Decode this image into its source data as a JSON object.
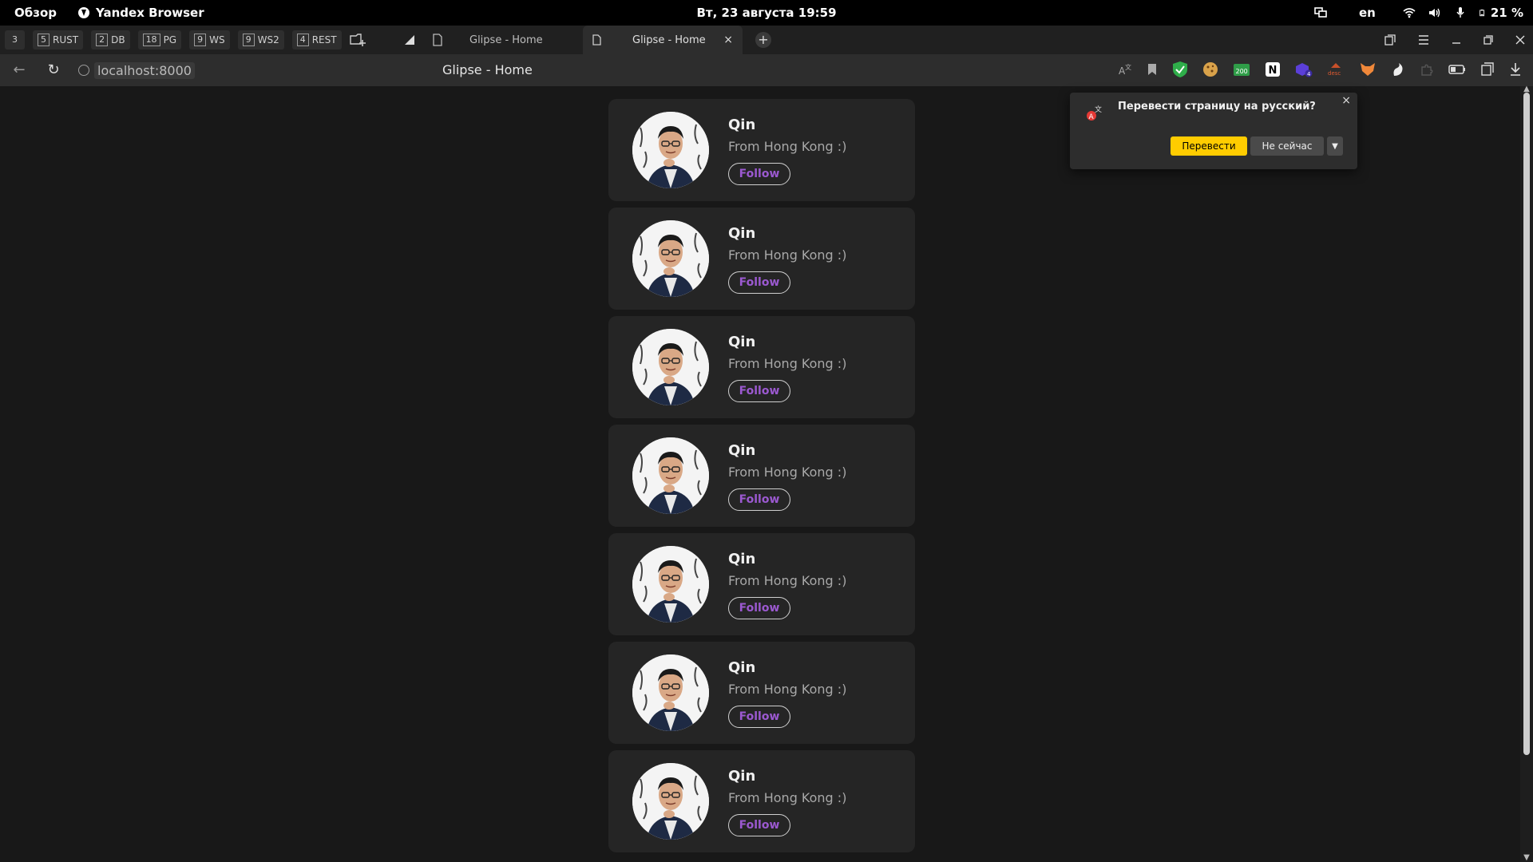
{
  "system_bar": {
    "overview": "Обзор",
    "app_name": "Yandex Browser",
    "clock": "Вт, 23 августа  19:59",
    "lang": "en",
    "battery": "21 %"
  },
  "workspaces": [
    {
      "num": "3",
      "label": ""
    },
    {
      "num": "5",
      "label": "RUST"
    },
    {
      "num": "2",
      "label": "DB"
    },
    {
      "num": "18",
      "label": "PG"
    },
    {
      "num": "9",
      "label": "WS"
    },
    {
      "num": "9",
      "label": "WS2"
    },
    {
      "num": "4",
      "label": "REST"
    }
  ],
  "tabs": [
    {
      "title": "Glipse - Home"
    },
    {
      "title": "Glipse - Home",
      "close": "×"
    }
  ],
  "address": {
    "url": "localhost:8000",
    "page_title": "Glipse - Home"
  },
  "translate_popup": {
    "question": "Перевести страницу на русский?",
    "translate": "Перевести",
    "not_now": "Не сейчас"
  },
  "users": [
    {
      "name": "Qin",
      "bio": "From Hong Kong :)",
      "follow": "Follow"
    },
    {
      "name": "Qin",
      "bio": "From Hong Kong :)",
      "follow": "Follow"
    },
    {
      "name": "Qin",
      "bio": "From Hong Kong :)",
      "follow": "Follow"
    },
    {
      "name": "Qin",
      "bio": "From Hong Kong :)",
      "follow": "Follow"
    },
    {
      "name": "Qin",
      "bio": "From Hong Kong :)",
      "follow": "Follow"
    },
    {
      "name": "Qin",
      "bio": "From Hong Kong :)",
      "follow": "Follow"
    },
    {
      "name": "Qin",
      "bio": "From Hong Kong :)",
      "follow": "Follow"
    }
  ],
  "colors": {
    "follow_text": "#9b59d0",
    "translate_button": "#ffcc00"
  }
}
